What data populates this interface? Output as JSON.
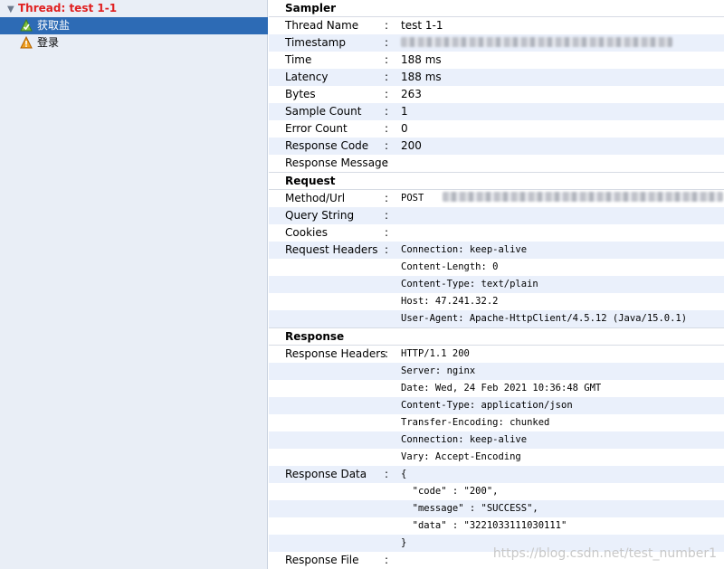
{
  "tree": {
    "thread_label": "Thread: test 1-1",
    "samples": [
      {
        "label": "获取盐",
        "status": "success"
      },
      {
        "label": "登录",
        "status": "warning"
      }
    ]
  },
  "sampler": {
    "title": "Sampler",
    "rows": [
      {
        "key": "Thread Name",
        "value": "test 1-1"
      },
      {
        "key": "Timestamp",
        "value": ""
      },
      {
        "key": "Time",
        "value": "188 ms"
      },
      {
        "key": "Latency",
        "value": "188 ms"
      },
      {
        "key": "Bytes",
        "value": "263"
      },
      {
        "key": "Sample Count",
        "value": "1"
      },
      {
        "key": "Error Count",
        "value": "0"
      },
      {
        "key": "Response Code",
        "value": "200"
      },
      {
        "key": "Response Message",
        "value": ""
      }
    ]
  },
  "request": {
    "title": "Request",
    "method_key": "Method/Url",
    "method_value": "POST",
    "query_key": "Query String",
    "cookies_key": "Cookies",
    "headers_key": "Request Headers",
    "headers": [
      "Connection: keep-alive",
      "Content-Length: 0",
      "Content-Type: text/plain",
      "Host: 47.241.32.2",
      "User-Agent: Apache-HttpClient/4.5.12 (Java/15.0.1)"
    ]
  },
  "response": {
    "title": "Response",
    "headers_key": "Response Headers",
    "headers": [
      "HTTP/1.1 200",
      "Server: nginx",
      "Date: Wed, 24 Feb 2021 10:36:48 GMT",
      "Content-Type: application/json",
      "Transfer-Encoding: chunked",
      "Connection: keep-alive",
      "Vary: Accept-Encoding"
    ],
    "data_key": "Response Data",
    "data_lines": [
      "{",
      "  \"code\" : \"200\",",
      "  \"message\" : \"SUCCESS\",",
      "  \"data\" : \"3221033111030111\"",
      "}"
    ],
    "file_key": "Response File"
  },
  "watermark": "https://blog.csdn.net/test_number1",
  "colors": {
    "selected": "#2d6bb5",
    "thread_red": "#e02020",
    "alt_row": "#eaf0fb",
    "tree_bg": "#e9eef6"
  }
}
